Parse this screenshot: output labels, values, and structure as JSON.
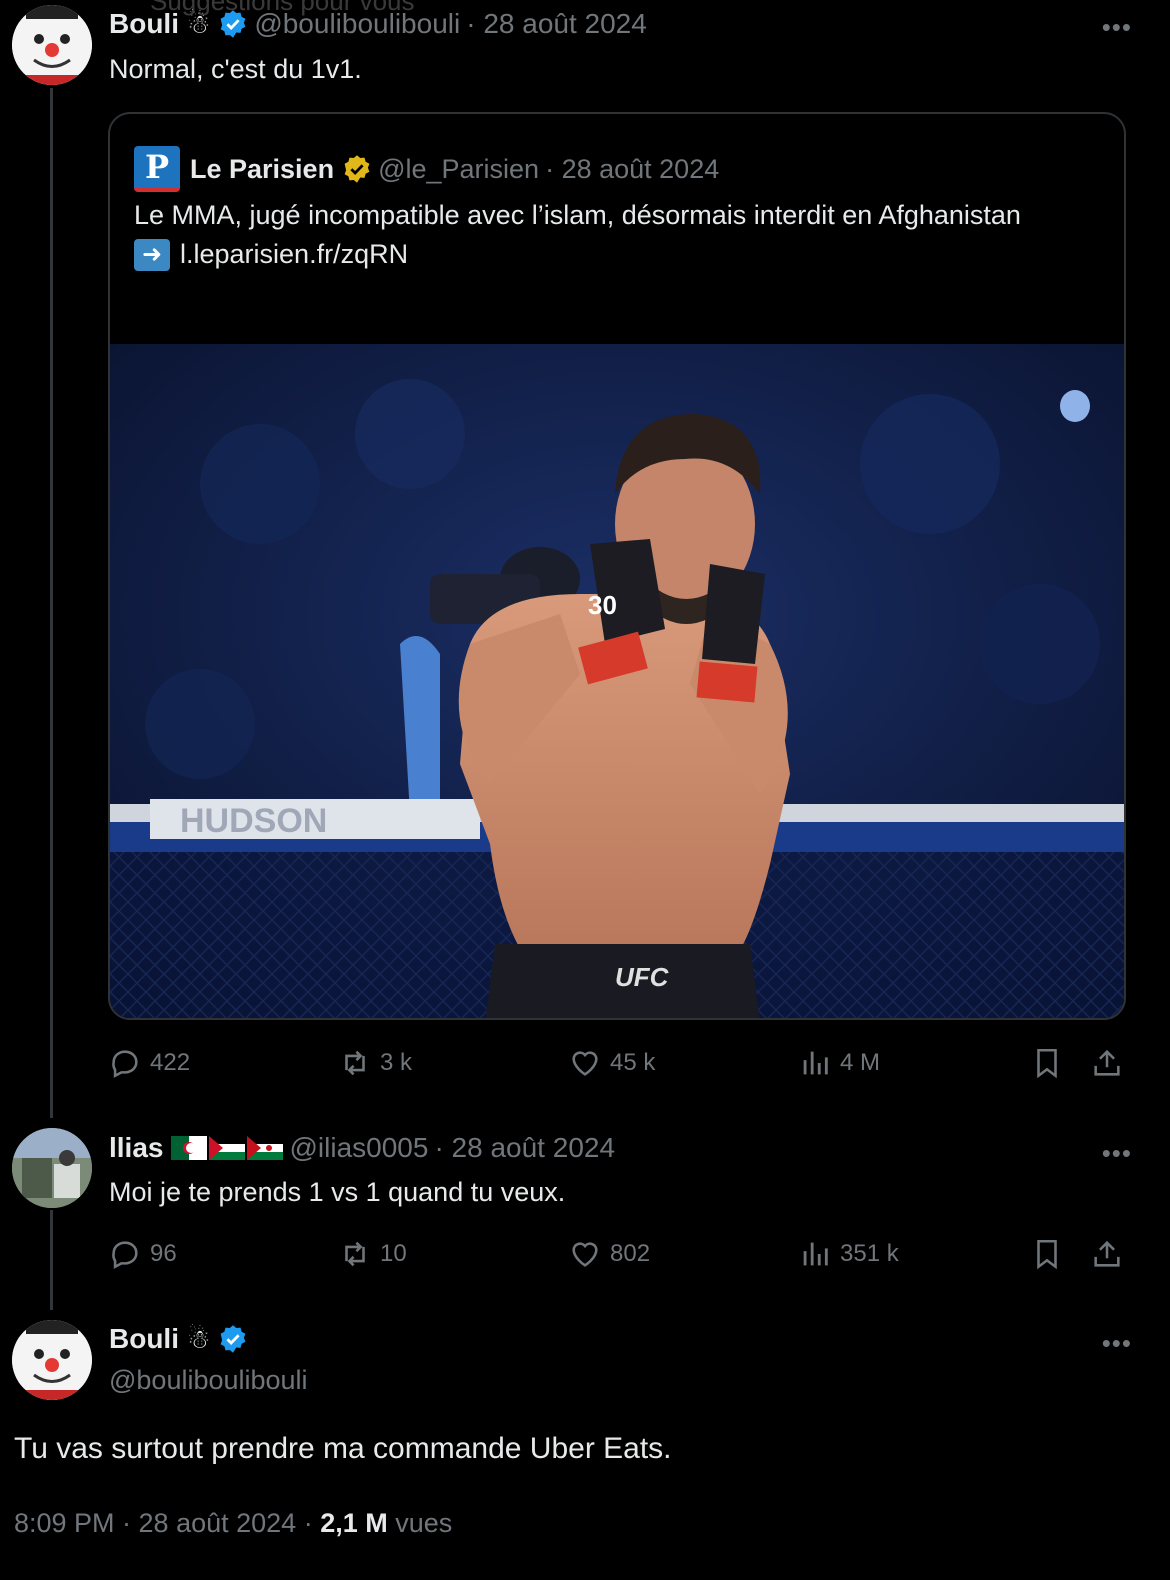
{
  "top_faded": "Suggestions pour vous",
  "tweet1": {
    "name": "Bouli",
    "name_emoji": "☃",
    "handle": "@bouliboulibouli",
    "date": "· 28 août 2024",
    "text": "Normal, c'est du 1v1.",
    "quote": {
      "name": "Le Parisien",
      "handle": "@le_Parisien",
      "date": "· 28 août 2024",
      "text": "Le MMA, jugé incompatible avec l’islam, désormais interdit en Afghanistan",
      "link": "l.leparisien.fr/zqRN",
      "photo_logo": "UFC",
      "photo_banner": "HUDSON",
      "glove_number": "30"
    },
    "actions": {
      "replies": "422",
      "reposts": "3 k",
      "likes": "45 k",
      "views": "4 M"
    }
  },
  "tweet2": {
    "name": "llias",
    "handle": "@ilias0005",
    "date": "· 28 août 2024",
    "text": "Moi je te prends 1 vs 1 quand tu veux.",
    "actions": {
      "replies": "96",
      "reposts": "10",
      "likes": "802",
      "views": "351 k"
    }
  },
  "tweet3": {
    "name": "Bouli",
    "name_emoji": "☃",
    "handle": "@bouliboulibouli",
    "text": "Tu vas surtout prendre ma commande Uber Eats.",
    "time": "8:09 PM · 28 août 2024 · ",
    "views_count": "2,1 M",
    "views_label": " vues"
  },
  "colors": {
    "verified": "#1d9bf0",
    "gold": "#e2b719",
    "muted": "#71767b"
  }
}
